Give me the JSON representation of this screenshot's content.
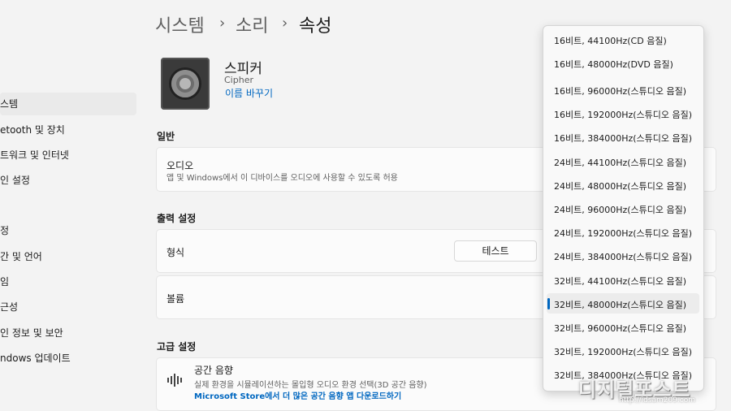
{
  "breadcrumb": {
    "items": [
      "시스템",
      "소리",
      "속성"
    ]
  },
  "sidebar": {
    "items": [
      {
        "label": "스템",
        "selected": true
      },
      {
        "label": "etooth 및 장치"
      },
      {
        "label": "트워크 및 인터넷"
      },
      {
        "label": "인 설정"
      },
      {
        "label": "정"
      },
      {
        "label": "간 및 언어"
      },
      {
        "label": "임"
      },
      {
        "label": "근성"
      },
      {
        "label": "인 정보 및 보안"
      },
      {
        "label": "ndows 업데이트"
      }
    ]
  },
  "device": {
    "name": "스피커",
    "subtitle": "Cipher",
    "rename_link": "이름 바꾸기"
  },
  "sections": {
    "general": "일반",
    "output": "출력 설정",
    "advanced": "고급 설정"
  },
  "audio_card": {
    "title": "오디오",
    "desc": "앱 및 Windows에서 이 디바이스를 오디오에 사용할 수 있도록 허용"
  },
  "format_card": {
    "title": "형식",
    "test_button": "테스트"
  },
  "volume_card": {
    "title": "볼륨"
  },
  "spatial_card": {
    "title": "공간 음향",
    "desc": "실제 환경을 시뮬레이션하는 몰입형 오디오 환경 선택(3D 공간 음향)",
    "link": "Microsoft Store에서 더 많은 공간 음향 앱 다운로드하기"
  },
  "format_dropdown": {
    "options": [
      "16비트, 44100Hz(CD 음질)",
      "16비트, 48000Hz(DVD 음질)",
      "16비트, 96000Hz(스튜디오 음질)",
      "16비트, 192000Hz(스튜디오 음질)",
      "16비트, 384000Hz(스튜디오 음질)",
      "24비트, 44100Hz(스튜디오 음질)",
      "24비트, 48000Hz(스튜디오 음질)",
      "24비트, 96000Hz(스튜디오 음질)",
      "24비트, 192000Hz(스튜디오 음질)",
      "24비트, 384000Hz(스튜디오 음질)",
      "32비트, 44100Hz(스튜디오 음질)",
      "32비트, 48000Hz(스튜디오 음질)",
      "32비트, 96000Hz(스튜디오 음질)",
      "32비트, 192000Hz(스튜디오 음질)",
      "32비트, 384000Hz(스튜디오 음질)"
    ],
    "selected_index": 11
  },
  "watermark": {
    "text": "디지털포스트",
    "url": "http://idsam209.com"
  },
  "colors": {
    "accent": "#0067c0",
    "background": "#f3f3f3",
    "card": "#fbfbfb"
  }
}
